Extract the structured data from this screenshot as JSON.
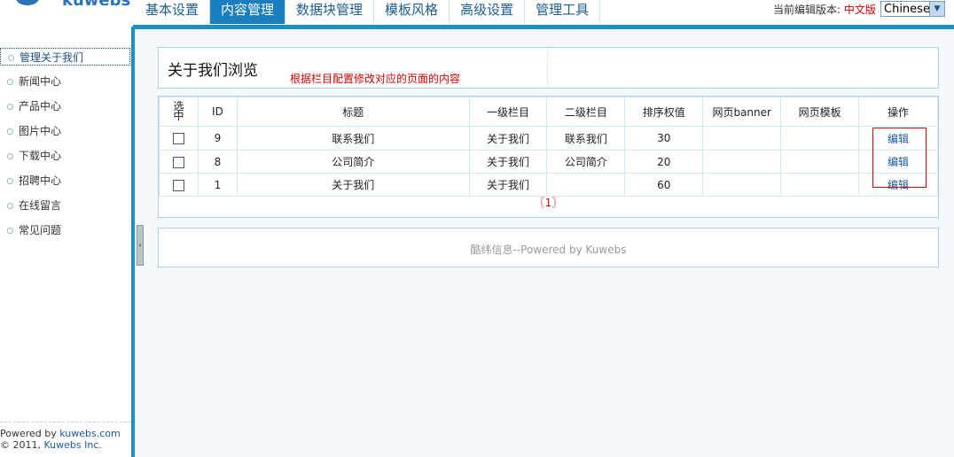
{
  "logo": {
    "text": "kuwebs"
  },
  "nav": {
    "tabs": [
      "基本设置",
      "内容管理",
      "数据块管理",
      "模板风格",
      "高级设置",
      "管理工具"
    ],
    "active_index": 1
  },
  "edition": {
    "label": "当前编辑版本:",
    "current": "中文版",
    "language_select": "Chinese"
  },
  "sidebar": {
    "items": [
      "管理关于我们",
      "新闻中心",
      "产品中心",
      "图片中心",
      "下载中心",
      "招聘中心",
      "在线留言",
      "常见问题"
    ],
    "active_index": 0,
    "footer_prefix": "Powered by ",
    "footer_link": "kuwebs.com",
    "copyright_prefix": "© 2011, ",
    "copyright_link": "Kuwebs Inc."
  },
  "page": {
    "title": "关于我们浏览",
    "hint": "根据栏目配置修改对应的页面的内容"
  },
  "table": {
    "headers": {
      "select": "选中",
      "id": "ID",
      "title": "标题",
      "level1": "一级栏目",
      "level2": "二级栏目",
      "order": "排序权值",
      "banner": "网页banner",
      "template": "网页模板",
      "action": "操作"
    },
    "rows": [
      {
        "id": "9",
        "title": "联系我们",
        "level1": "关于我们",
        "level2": "联系我们",
        "order": "30",
        "banner": "",
        "template": "",
        "action": "编辑"
      },
      {
        "id": "8",
        "title": "公司简介",
        "level1": "关于我们",
        "level2": "公司简介",
        "order": "20",
        "banner": "",
        "template": "",
        "action": "编辑"
      },
      {
        "id": "1",
        "title": "关于我们",
        "level1": "关于我们",
        "level2": "",
        "order": "60",
        "banner": "",
        "template": "",
        "action": "编辑"
      }
    ],
    "pager": "〖1〗"
  },
  "footer": {
    "text": "酷纬信息--Powered by Kuwebs"
  },
  "colors": {
    "accent": "#1a8fc9",
    "active_tab": "#1a7fbe",
    "highlight": "#d40000",
    "link": "#1a5aa0"
  }
}
